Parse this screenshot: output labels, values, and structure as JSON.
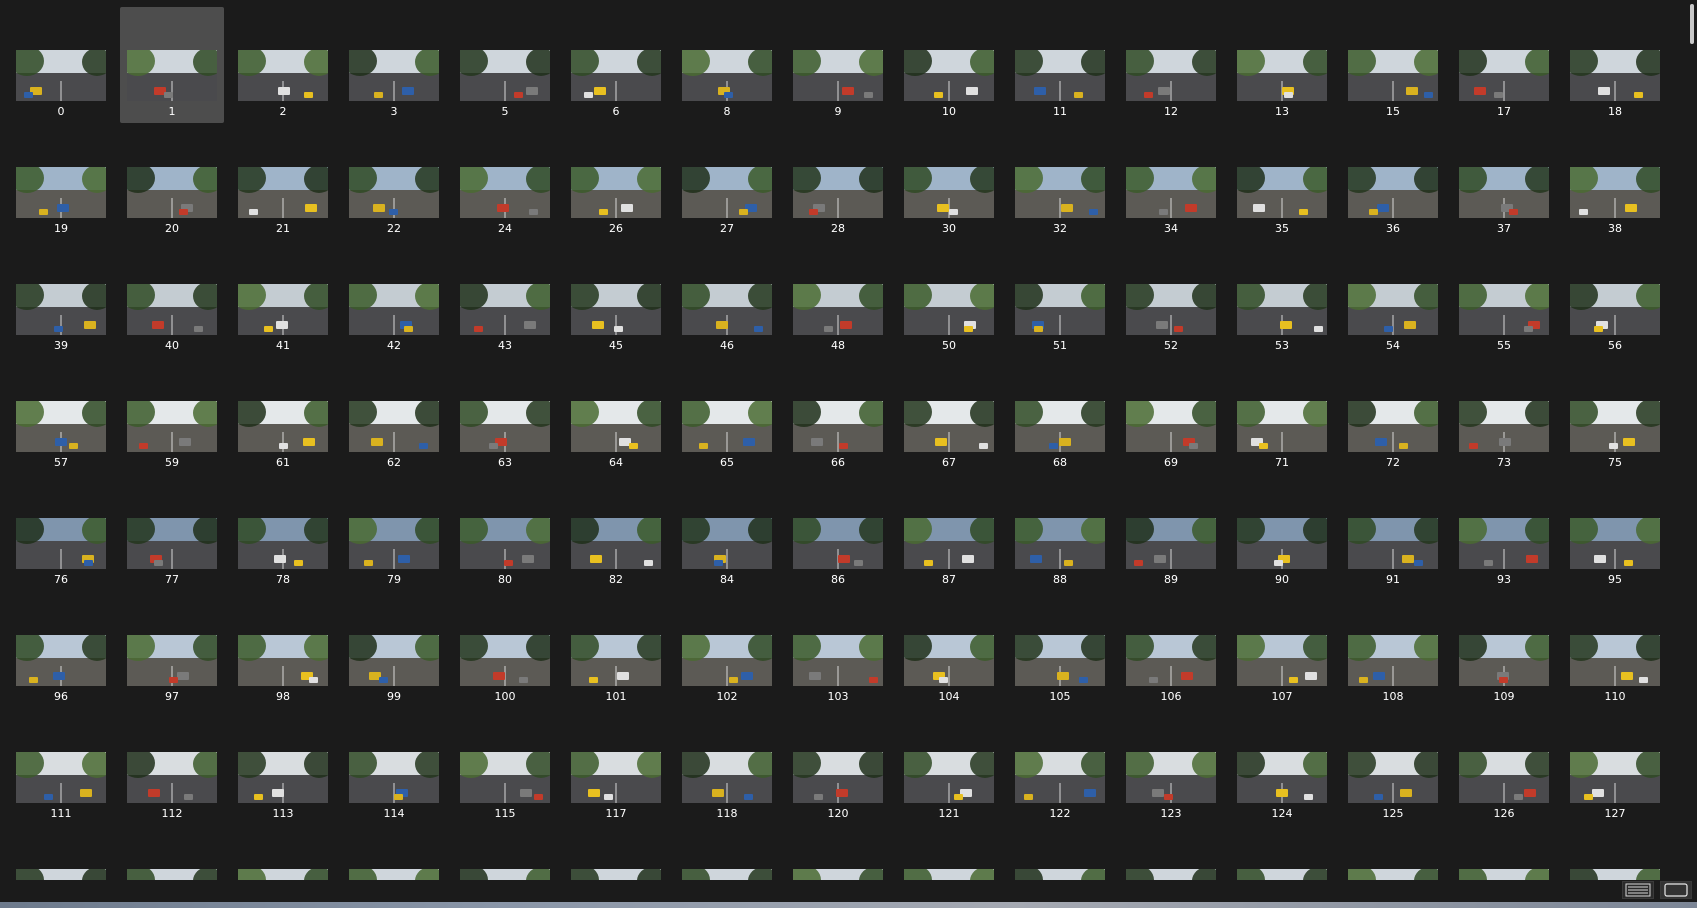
{
  "thumbnails": [
    "0",
    "1",
    "2",
    "3",
    "5",
    "6",
    "8",
    "9",
    "10",
    "11",
    "12",
    "13",
    "15",
    "17",
    "18",
    "19",
    "20",
    "21",
    "22",
    "24",
    "26",
    "27",
    "28",
    "30",
    "32",
    "34",
    "35",
    "36",
    "37",
    "38",
    "39",
    "40",
    "41",
    "42",
    "43",
    "45",
    "46",
    "48",
    "50",
    "51",
    "52",
    "53",
    "54",
    "55",
    "56",
    "57",
    "59",
    "61",
    "62",
    "63",
    "64",
    "65",
    "66",
    "67",
    "68",
    "69",
    "71",
    "72",
    "73",
    "75",
    "76",
    "77",
    "78",
    "79",
    "80",
    "82",
    "84",
    "86",
    "87",
    "88",
    "89",
    "90",
    "91",
    "93",
    "95",
    "96",
    "97",
    "98",
    "99",
    "100",
    "101",
    "102",
    "103",
    "104",
    "105",
    "106",
    "107",
    "108",
    "109",
    "110",
    "111",
    "112",
    "113",
    "114",
    "115",
    "117",
    "118",
    "120",
    "121",
    "122",
    "123",
    "124",
    "125",
    "126",
    "127",
    "",
    "",
    "",
    "",
    "",
    "",
    "",
    "",
    "",
    "",
    "",
    "",
    "",
    "",
    ""
  ],
  "selected_index": 1,
  "colors": {
    "background": "#1b1b1b",
    "selected_tile": "#4d4d4d",
    "label_text": "#ffffff"
  },
  "icons": {
    "details_view": "details-view-icon",
    "thumbnail_view": "large-icons-view-icon"
  }
}
